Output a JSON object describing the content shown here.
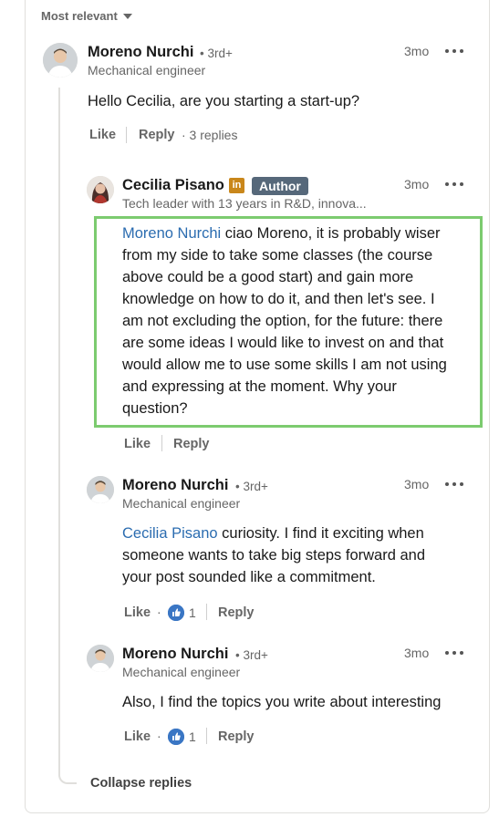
{
  "sort": {
    "label": "Most relevant"
  },
  "comments": [
    {
      "author": "Moreno Nurchi",
      "degree": "• 3rd+",
      "headline": "Mechanical engineer",
      "time": "3mo",
      "text": "Hello Cecilia, are you starting a start-up?",
      "like_label": "Like",
      "reply_label": "Reply",
      "replies_label": "· 3 replies"
    }
  ],
  "replies": [
    {
      "author": "Cecilia Pisano",
      "badge_li": "in",
      "author_badge": "Author",
      "headline": "Tech leader with 13 years in R&D, innova...",
      "time": "3mo",
      "mention": "Moreno Nurchi",
      "lines": [
        " ciao Moreno, it is probably wiser",
        "from my side to take some classes (the course",
        "above could be a good start) and gain more",
        "knowledge on how to do it, and then let's see. I",
        "am not excluding the option, for the future: there",
        "are some ideas I would like to invest on and that",
        "would allow me to use some skills I am not using",
        "and expressing at the moment. Why your",
        "question?"
      ],
      "like_label": "Like",
      "reply_label": "Reply"
    },
    {
      "author": "Moreno Nurchi",
      "degree": "• 3rd+",
      "headline": "Mechanical engineer",
      "time": "3mo",
      "mention": "Cecilia Pisano",
      "lines": [
        " curiosity. I find it exciting when",
        "someone wants to take big steps forward and",
        "your post sounded like a commitment."
      ],
      "like_label": "Like",
      "reaction_dot": "·",
      "reaction_count": "1",
      "reply_label": "Reply"
    },
    {
      "author": "Moreno Nurchi",
      "degree": "• 3rd+",
      "headline": "Mechanical engineer",
      "time": "3mo",
      "text": "Also, I find the topics you write about interesting",
      "like_label": "Like",
      "reaction_dot": "·",
      "reaction_count": "1",
      "reply_label": "Reply"
    }
  ],
  "collapse_label": "Collapse replies",
  "colors": {
    "highlight_border": "#7ccb6f",
    "mention": "#2b6cb0",
    "li_badge": "#c9871b",
    "author_badge": "#56687a"
  }
}
